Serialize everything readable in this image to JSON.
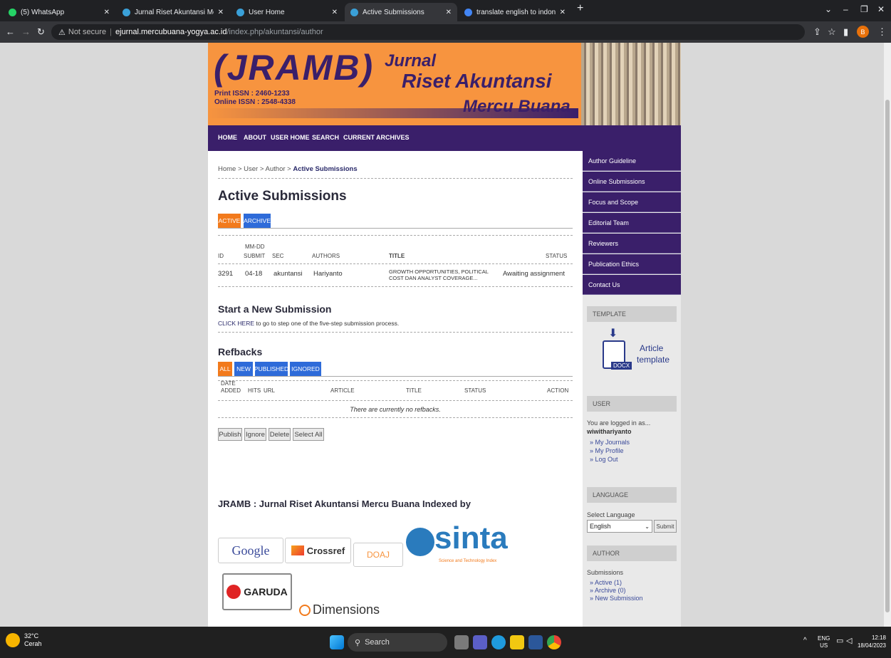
{
  "browser": {
    "tabs": [
      {
        "label": "(5) WhatsApp",
        "color": "#25d366"
      },
      {
        "label": "Jurnal Riset Akuntansi Mercu Bu",
        "color": "#3aa0d8"
      },
      {
        "label": "User Home",
        "color": "#3aa0d8"
      },
      {
        "label": "Active Submissions",
        "color": "#3aa0d8"
      },
      {
        "label": "translate english to indonesia - G",
        "color": "#4285f4"
      }
    ],
    "not_secure": "Not secure",
    "url_domain": "ejurnal.mercubuana-yogya.ac.id",
    "url_path": "/index.php/akuntansi/author",
    "profile_initial": "B"
  },
  "header": {
    "logo_text": "JRAMB",
    "issn_print": "Print ISSN : 2460-1233",
    "issn_online": "Online ISSN : 2548-4338",
    "title_1": "Jurnal",
    "title_2": "Riset Akuntansi",
    "title_3": "Mercu Buana"
  },
  "nav": [
    "HOME",
    "ABOUT",
    "USER HOME",
    "SEARCH",
    "CURRENT",
    "ARCHIVES"
  ],
  "breadcrumb": {
    "path": "Home > User > Author > ",
    "current": "Active Submissions"
  },
  "page_title": "Active Submissions",
  "tabs": {
    "active": "ACTIVE",
    "archive": "ARCHIVE"
  },
  "table": {
    "h_id": "ID",
    "h_mmdd": "MM-DD",
    "h_submit": "SUBMIT",
    "h_sec": "SEC",
    "h_authors": "AUTHORS",
    "h_title": "TITLE",
    "h_status": "STATUS",
    "row": {
      "id": "3291",
      "submit": "04-18",
      "sec": "akuntansi",
      "authors": "Hariyanto",
      "title_line1": "GROWTH OPPORTUNITIES, POLITICAL",
      "title_line2": "COST DAN ANALYST COVERAGE...",
      "status": "Awaiting assignment"
    }
  },
  "new_submission": {
    "heading": "Start a New Submission",
    "link": "CLICK HERE",
    "text": " to go to step one of the five-step submission process."
  },
  "refbacks": {
    "heading": "Refbacks",
    "filters": [
      "ALL",
      "NEW",
      "PUBLISHED",
      "IGNORED"
    ],
    "h_date": "DATE",
    "h_added": "ADDED",
    "h_hits": "HITS",
    "h_url": "URL",
    "h_article": "ARTICLE",
    "h_title": "TITLE",
    "h_status": "STATUS",
    "h_action": "ACTION",
    "empty": "There are currently no refbacks.",
    "buttons": [
      "Publish",
      "Ignore",
      "Delete",
      "Select All"
    ]
  },
  "indexed": {
    "heading": "JRAMB : Jurnal Riset Akuntansi Mercu Buana Indexed by",
    "google": "Google",
    "crossref": "Crossref",
    "doaj": "DOAJ",
    "sinta": "sinta",
    "sinta_sub": "Science and Technology Index",
    "garuda": "GARUDA",
    "dimensions": "Dimensions"
  },
  "sidebar": {
    "links": [
      "Author Guideline",
      "Online Submissions",
      "Focus and Scope",
      "Editorial Team",
      "Reviewers",
      "Publication Ethics",
      "Contact Us"
    ],
    "template_head": "TEMPLATE",
    "template_label_1": "Article",
    "template_label_2": "template",
    "docx": "DOCX",
    "user_head": "USER",
    "logged_in_as": "You are logged in as...",
    "username": "wiwithariyanto",
    "user_links": [
      "» My Journals",
      "» My Profile",
      "» Log Out"
    ],
    "language_head": "LANGUAGE",
    "select_language": "Select Language",
    "language_value": "English",
    "submit": "Submit",
    "author_head": "AUTHOR",
    "submissions": "Submissions",
    "author_links": [
      "» Active (1)",
      "» Archive (0)",
      "» New Submission"
    ]
  },
  "taskbar": {
    "temp": "32°C",
    "weather": "Cerah",
    "search": "Search",
    "lang_1": "ENG",
    "lang_2": "US",
    "time": "12:18",
    "date": "18/04/2023"
  }
}
